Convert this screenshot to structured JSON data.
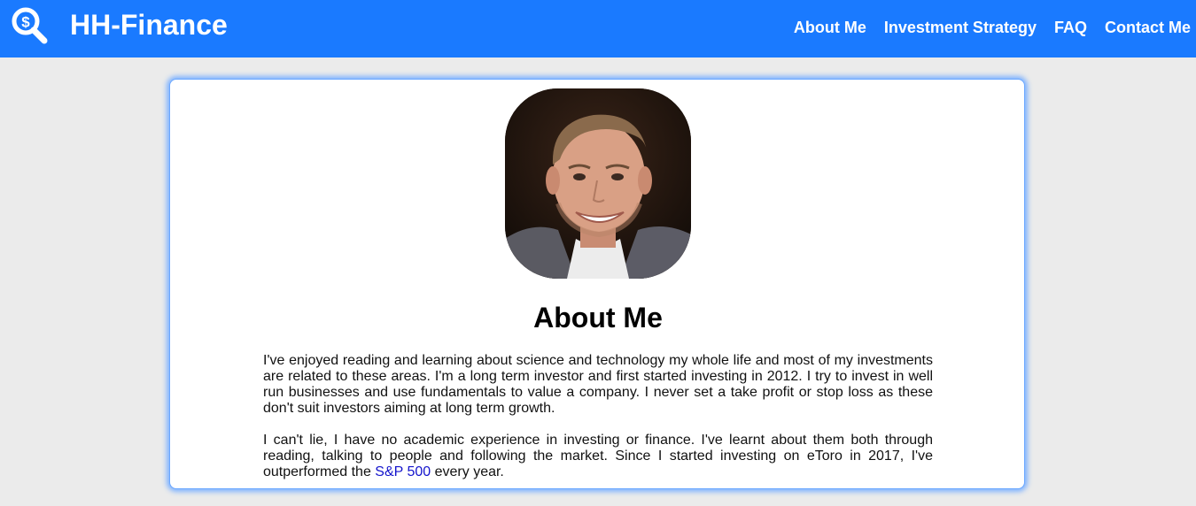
{
  "nav": {
    "brand": "HH-Finance",
    "logo_icon": "dollar-magnifier-icon",
    "links": [
      {
        "label": "About Me"
      },
      {
        "label": "Investment Strategy"
      },
      {
        "label": "FAQ"
      },
      {
        "label": "Contact Me"
      }
    ]
  },
  "colors": {
    "navbar": "#1a7aff",
    "page_background": "#ebebeb",
    "card_glow": "#7fb3ff",
    "link": "#1414cc"
  },
  "about": {
    "heading": "About Me",
    "paragraph_1": "I've enjoyed reading and learning about science and technology my whole life and most of my investments are related to these areas. I'm a long term investor and first started investing in 2012. I try to invest in well run businesses and use fundamentals to value a company. I never set a take profit or stop loss as these don't suit investors aiming at long term growth.",
    "paragraph_2_before": "I can't lie, I have no academic experience in investing or finance. I've learnt about them both through reading, talking to people and following the market. Since I started investing on eToro in 2017, I've outperformed the ",
    "paragraph_2_link": "S&P 500",
    "paragraph_2_after": " every year."
  }
}
